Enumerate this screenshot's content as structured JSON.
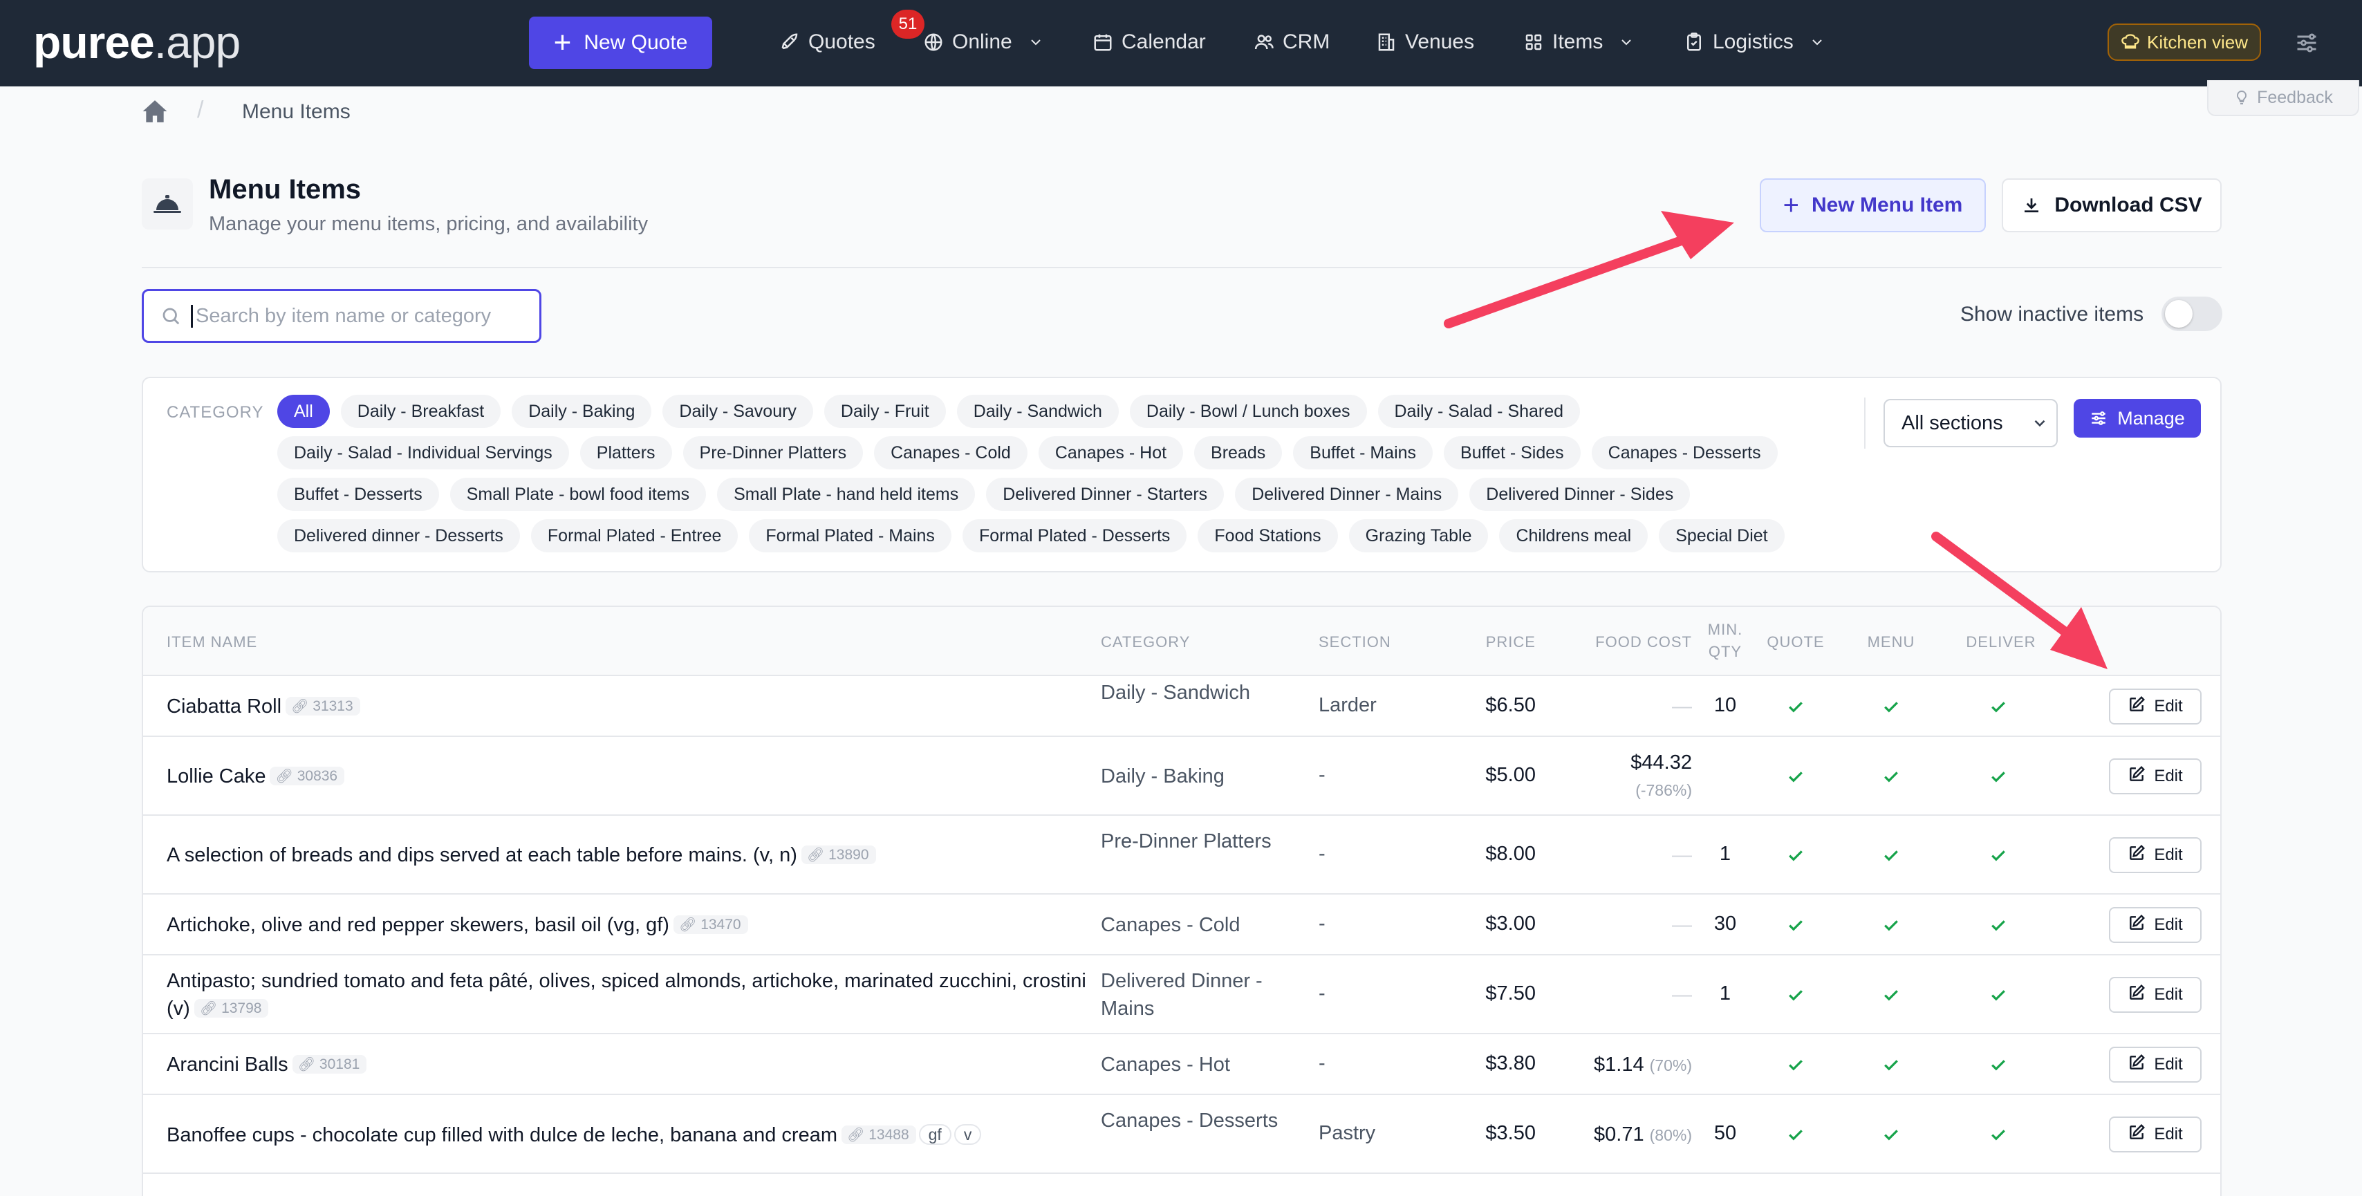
{
  "nav": {
    "logo_main": "puree",
    "logo_suffix": ".app",
    "new_quote_label": "New Quote",
    "items": [
      {
        "label": "Quotes",
        "icon": "rocket-icon"
      },
      {
        "label": "Online",
        "icon": "globe-icon"
      },
      {
        "label": "Calendar",
        "icon": "calendar-icon"
      },
      {
        "label": "CRM",
        "icon": "users-icon"
      },
      {
        "label": "Venues",
        "icon": "building-icon"
      },
      {
        "label": "Items",
        "icon": "grid-icon"
      },
      {
        "label": "Logistics",
        "icon": "clipboard-icon"
      }
    ],
    "quotes_badge": "51",
    "kitchen_view_label": "Kitchen view"
  },
  "breadcrumb": {
    "current": "Menu Items"
  },
  "feedback_label": "Feedback",
  "header": {
    "title": "Menu Items",
    "subtitle": "Manage your menu items, pricing, and availability",
    "new_item_label": "New Menu Item",
    "download_label": "Download CSV"
  },
  "search": {
    "placeholder": "Search by item name or category",
    "value": ""
  },
  "show_inactive_label": "Show inactive items",
  "show_inactive": false,
  "filters": {
    "category_label": "CATEGORY",
    "chips": [
      [
        "All",
        "Daily - Breakfast",
        "Daily - Baking",
        "Daily - Savoury",
        "Daily - Fruit",
        "Daily - Sandwich",
        "Daily - Bowl / Lunch boxes",
        "Daily - Salad - Shared"
      ],
      [
        "Daily - Salad - Individual Servings",
        "Platters",
        "Pre-Dinner Platters",
        "Canapes - Cold",
        "Canapes - Hot",
        "Breads",
        "Buffet - Mains",
        "Buffet - Sides",
        "Canapes - Desserts"
      ],
      [
        "Buffet - Desserts",
        "Small Plate - bowl food items",
        "Small Plate - hand held items",
        "Delivered Dinner - Starters",
        "Delivered Dinner - Mains",
        "Delivered Dinner - Sides"
      ],
      [
        "Delivered dinner - Desserts",
        "Formal Plated - Entree",
        "Formal Plated - Mains",
        "Formal Plated - Desserts",
        "Food Stations",
        "Grazing Table",
        "Childrens meal",
        "Special Diet"
      ]
    ],
    "active_chip": "All",
    "sections_value": "All sections",
    "manage_label": "Manage"
  },
  "table": {
    "headers": {
      "name": "ITEM NAME",
      "category": "CATEGORY",
      "section": "SECTION",
      "price": "PRICE",
      "food_cost": "FOOD COST",
      "min_qty_1": "MIN.",
      "min_qty_2": "QTY",
      "quote": "QUOTE",
      "menu": "MENU",
      "delivery": "DELIVER"
    },
    "edit_label": "Edit",
    "rows": [
      {
        "name": "Ciabatta Roll",
        "id": "31313",
        "tags": [],
        "category": "Daily - Sandwich",
        "section": "Larder",
        "price": "$6.50",
        "food_cost": "—",
        "food_cost_pct": "",
        "min_qty": "10"
      },
      {
        "name": "Lollie Cake",
        "id": "30836",
        "tags": [],
        "category": "Daily - Baking",
        "section": "-",
        "price": "$5.00",
        "food_cost": "$44.32",
        "food_cost_pct": "(-786%)",
        "min_qty": ""
      },
      {
        "name": "A selection of breads and dips served at each table before mains. (v, n)",
        "id": "13890",
        "tags": [],
        "category": "Pre-Dinner Platters",
        "section": "-",
        "price": "$8.00",
        "food_cost": "—",
        "food_cost_pct": "",
        "min_qty": "1"
      },
      {
        "name": "Artichoke, olive and red pepper skewers, basil oil (vg, gf)",
        "id": "13470",
        "tags": [],
        "category": "Canapes - Cold",
        "section": "-",
        "price": "$3.00",
        "food_cost": "—",
        "food_cost_pct": "",
        "min_qty": "30"
      },
      {
        "name": "Antipasto; sundried tomato and feta pâté, olives, spiced almonds, artichoke, marinated zucchini, crostini (v)",
        "id": "13798",
        "tags": [],
        "category": "Delivered Dinner - Mains",
        "section": "-",
        "price": "$7.50",
        "food_cost": "—",
        "food_cost_pct": "",
        "min_qty": "1"
      },
      {
        "name": "Arancini Balls",
        "id": "30181",
        "tags": [],
        "category": "Canapes - Hot",
        "section": "-",
        "price": "$3.80",
        "food_cost": "$1.14",
        "food_cost_pct": "(70%)",
        "min_qty": ""
      },
      {
        "name": "Banoffee cups - chocolate cup filled with dulce de leche, banana and cream",
        "id": "13488",
        "tags": [
          "gf",
          "v"
        ],
        "category": "Canapes - Desserts",
        "section": "Pastry",
        "price": "$3.50",
        "food_cost": "$0.71",
        "food_cost_pct": "(80%)",
        "min_qty": "50"
      }
    ]
  },
  "colors": {
    "accent": "#4f46e5",
    "nav_bg": "#1f2937",
    "check": "#16a34a",
    "arrow": "#f43f5e",
    "badge": "#dc2626"
  }
}
